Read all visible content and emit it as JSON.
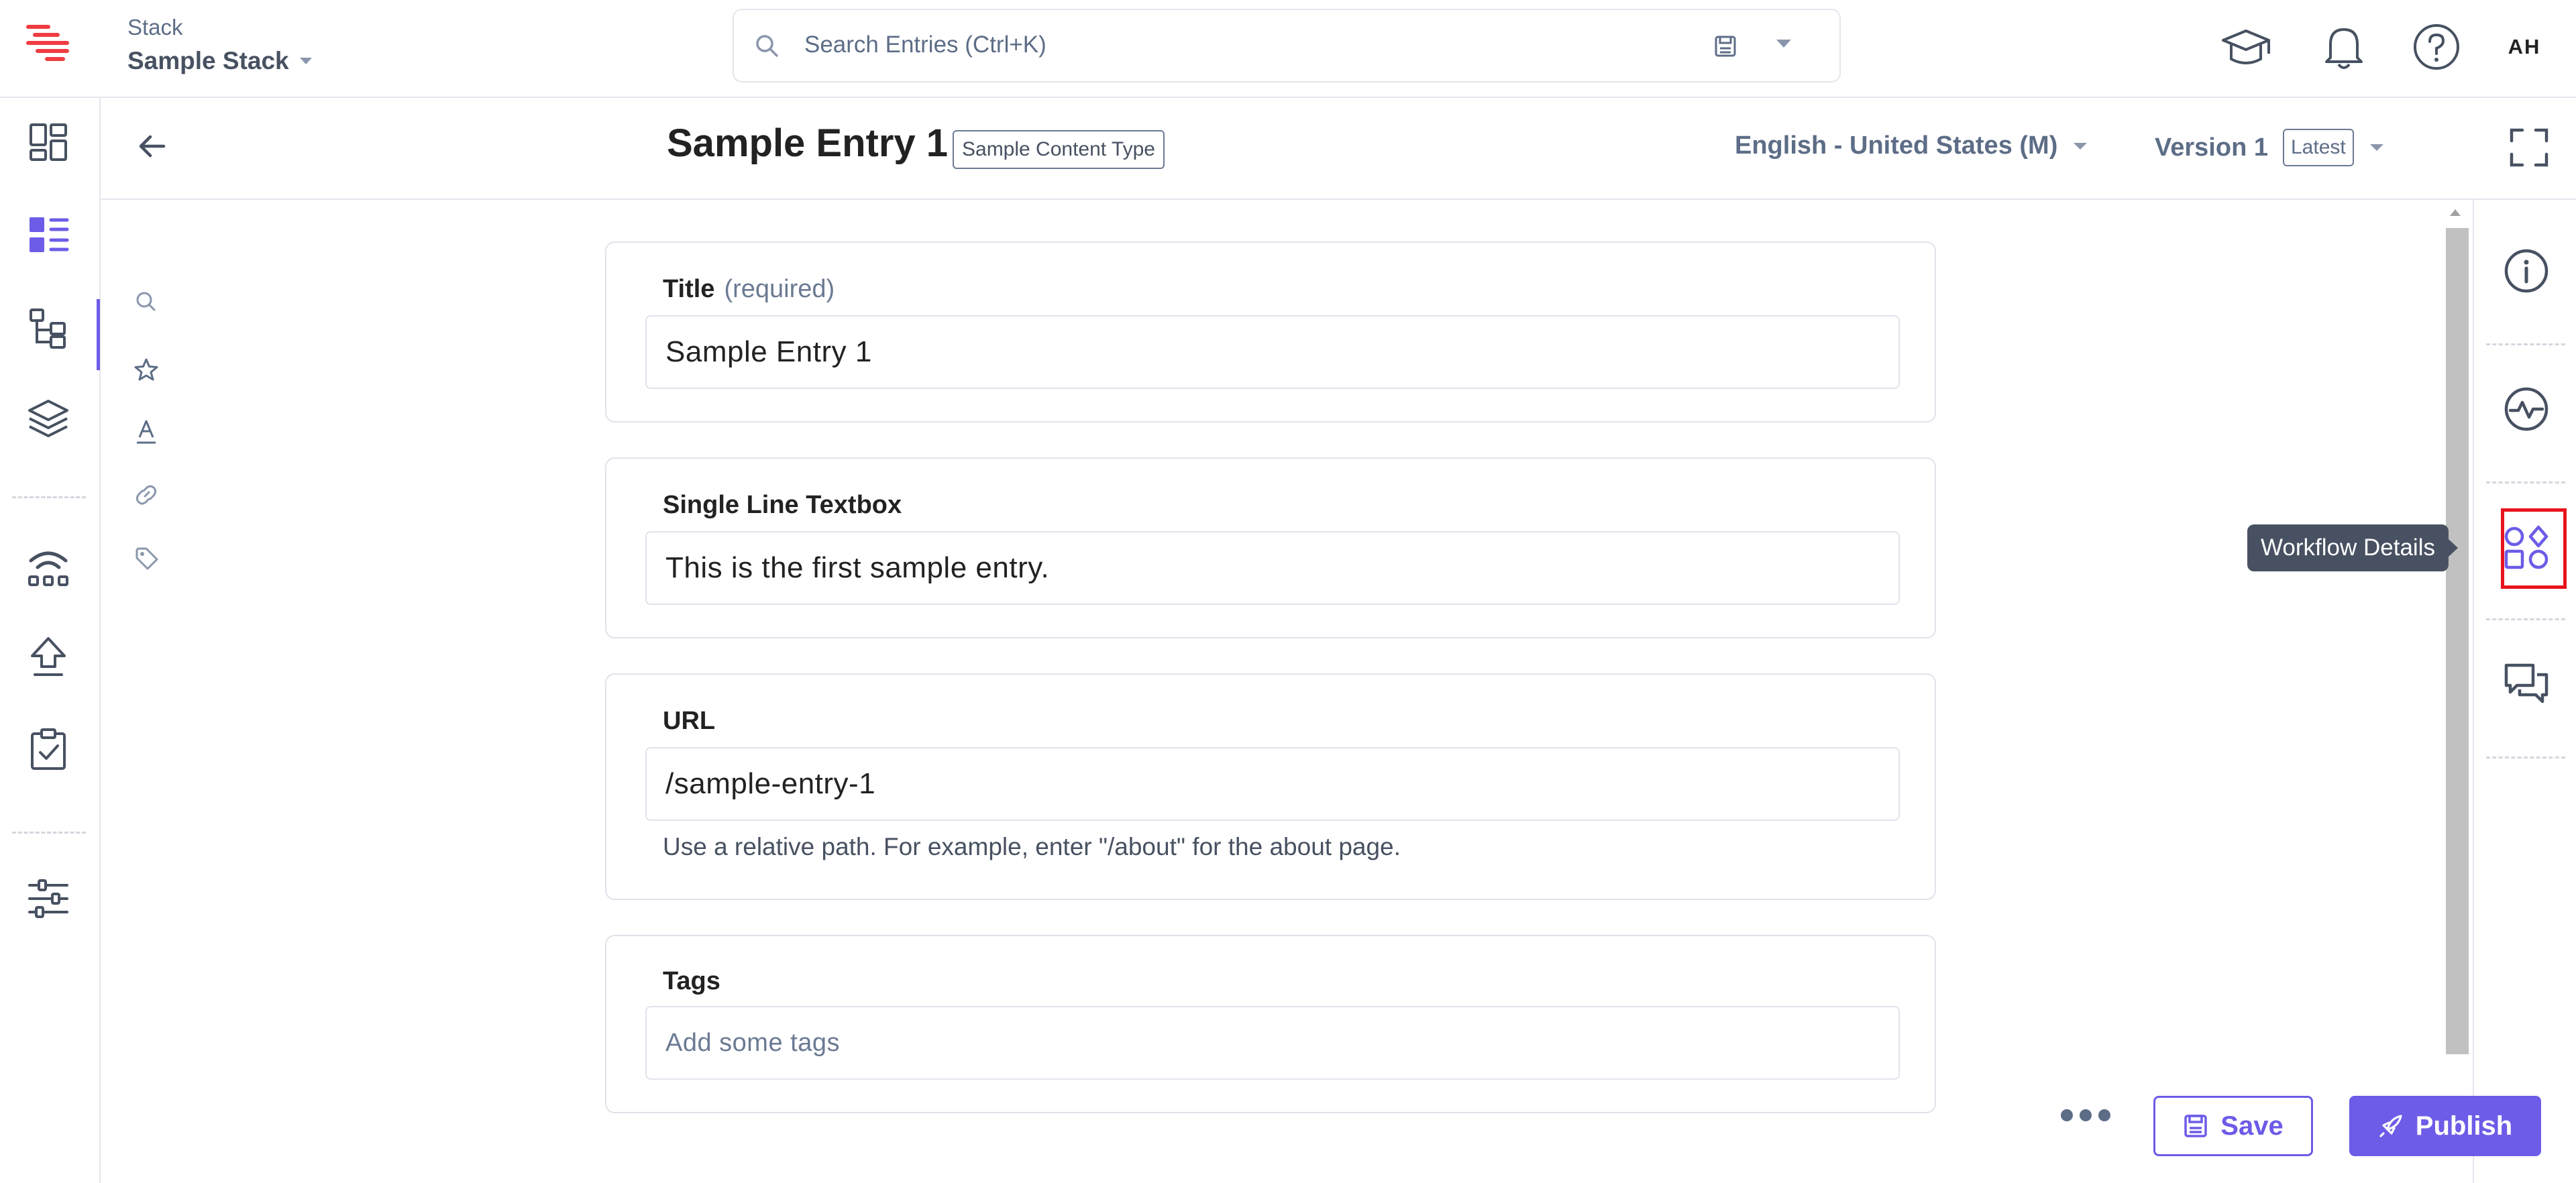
{
  "header": {
    "stack_label": "Stack",
    "stack_name": "Sample Stack",
    "search_placeholder": "Search Entries (Ctrl+K)",
    "avatar_initials": "AH",
    "icons": [
      "logo-icon",
      "search-icon",
      "save-icon",
      "caret-down-icon",
      "academy-icon",
      "bell-icon",
      "help-icon"
    ]
  },
  "left_nav": {
    "items": [
      {
        "name": "dashboard-icon"
      },
      {
        "name": "entries-icon",
        "active": true
      },
      {
        "name": "content-models-icon"
      },
      {
        "name": "assets-icon"
      },
      {
        "name": "releases-icon"
      },
      {
        "name": "publish-queue-icon"
      },
      {
        "name": "tasks-icon"
      },
      {
        "name": "settings-icon"
      }
    ]
  },
  "entry": {
    "title": "Sample Entry 1",
    "content_type": "Sample Content Type",
    "locale": "English - United States (M)",
    "version": "Version 1",
    "version_badge": "Latest"
  },
  "form": {
    "title_field": {
      "label": "Title",
      "qualifier": "(required)",
      "value": "Sample Entry 1"
    },
    "single_line_field": {
      "label": "Single Line Textbox",
      "value": "This is the first sample entry."
    },
    "url_field": {
      "label": "URL",
      "value": "/sample-entry-1",
      "help": "Use a relative path. For example, enter \"/about\" for the about page."
    },
    "tags_field": {
      "label": "Tags",
      "placeholder": "Add some tags"
    }
  },
  "right_sidebar": {
    "items": [
      "info-icon",
      "activity-icon",
      "workflow-details-icon",
      "comments-icon"
    ],
    "tooltip": "Workflow Details"
  },
  "actions": {
    "save_label": "Save",
    "publish_label": "Publish"
  },
  "colors": {
    "accent": "#6c5ce7",
    "icon": "#475161",
    "border": "#dfe3ea",
    "highlight": "#e8131c",
    "tooltip_bg": "#475161"
  }
}
